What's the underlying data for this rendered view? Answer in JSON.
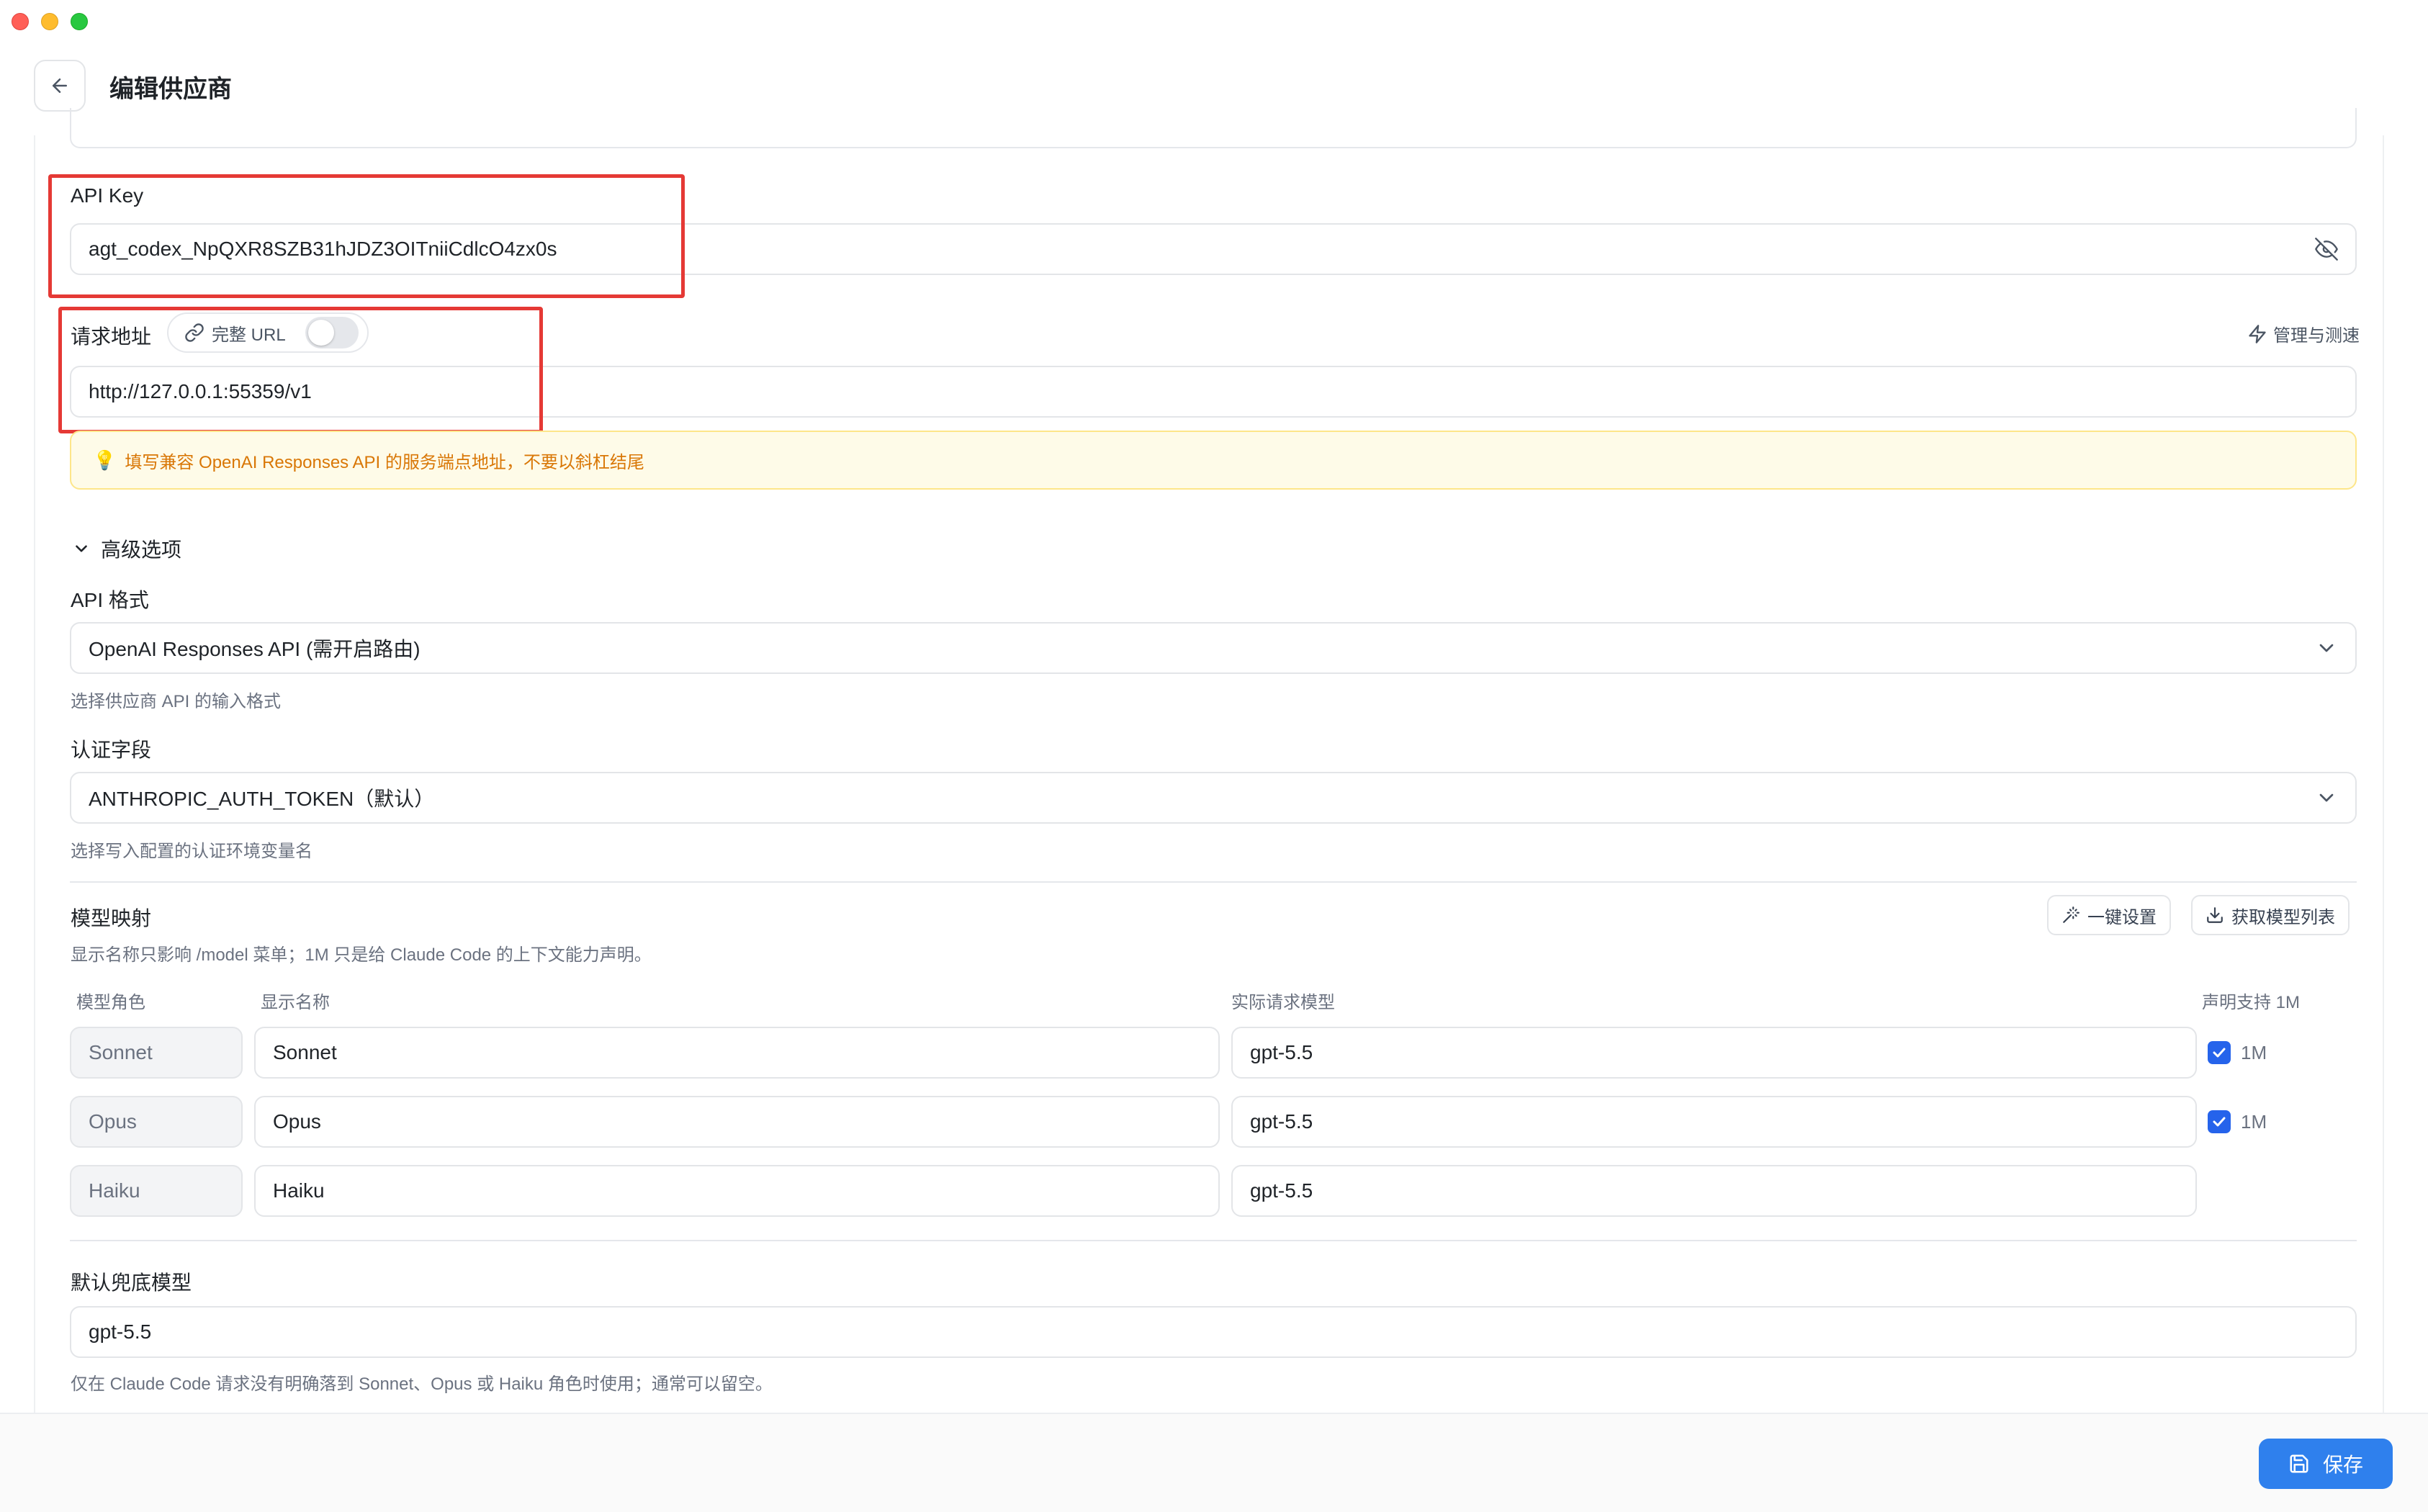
{
  "header": {
    "title": "编辑供应商"
  },
  "api_key": {
    "label": "API Key",
    "value": "agt_codex_NpQXR8SZB31hJDZ3OITniiCdlcO4zx0s"
  },
  "request_url": {
    "label": "请求地址",
    "full_url_label": "完整 URL",
    "full_url_enabled": false,
    "manage_link": "管理与测速",
    "value": "http://127.0.0.1:55359/v1",
    "tip": "填写兼容 OpenAI Responses API 的服务端点地址，不要以斜杠结尾"
  },
  "advanced": {
    "toggle_label": "高级选项",
    "api_format": {
      "label": "API 格式",
      "selected": "OpenAI Responses API (需开启路由)",
      "hint": "选择供应商 API 的输入格式"
    },
    "auth_field": {
      "label": "认证字段",
      "selected": "ANTHROPIC_AUTH_TOKEN（默认）",
      "hint": "选择写入配置的认证环境变量名"
    }
  },
  "model_mapping": {
    "title": "模型映射",
    "description": "显示名称只影响 /model 菜单；1M 只是给 Claude Code 的上下文能力声明。",
    "one_click_label": "一键设置",
    "fetch_label": "获取模型列表",
    "columns": [
      "模型角色",
      "显示名称",
      "实际请求模型",
      "声明支持 1M"
    ],
    "rows": [
      {
        "role": "Sonnet",
        "display": "Sonnet",
        "model": "gpt-5.5",
        "supports_1m": true,
        "badge": "1M"
      },
      {
        "role": "Opus",
        "display": "Opus",
        "model": "gpt-5.5",
        "supports_1m": true,
        "badge": "1M"
      },
      {
        "role": "Haiku",
        "display": "Haiku",
        "model": "gpt-5.5",
        "supports_1m": false,
        "badge": ""
      }
    ]
  },
  "fallback": {
    "label": "默认兜底模型",
    "value": "gpt-5.5",
    "hint": "仅在 Claude Code 请求没有明确落到 Sonnet、Opus 或 Haiku 角色时使用；通常可以留空。"
  },
  "footer": {
    "save_label": "保存"
  },
  "colors": {
    "accent": "#2f80ed",
    "checkbox": "#2563eb",
    "tip_text": "#d97706",
    "tip_bg": "#fefbe8",
    "highlight": "#e53935"
  }
}
